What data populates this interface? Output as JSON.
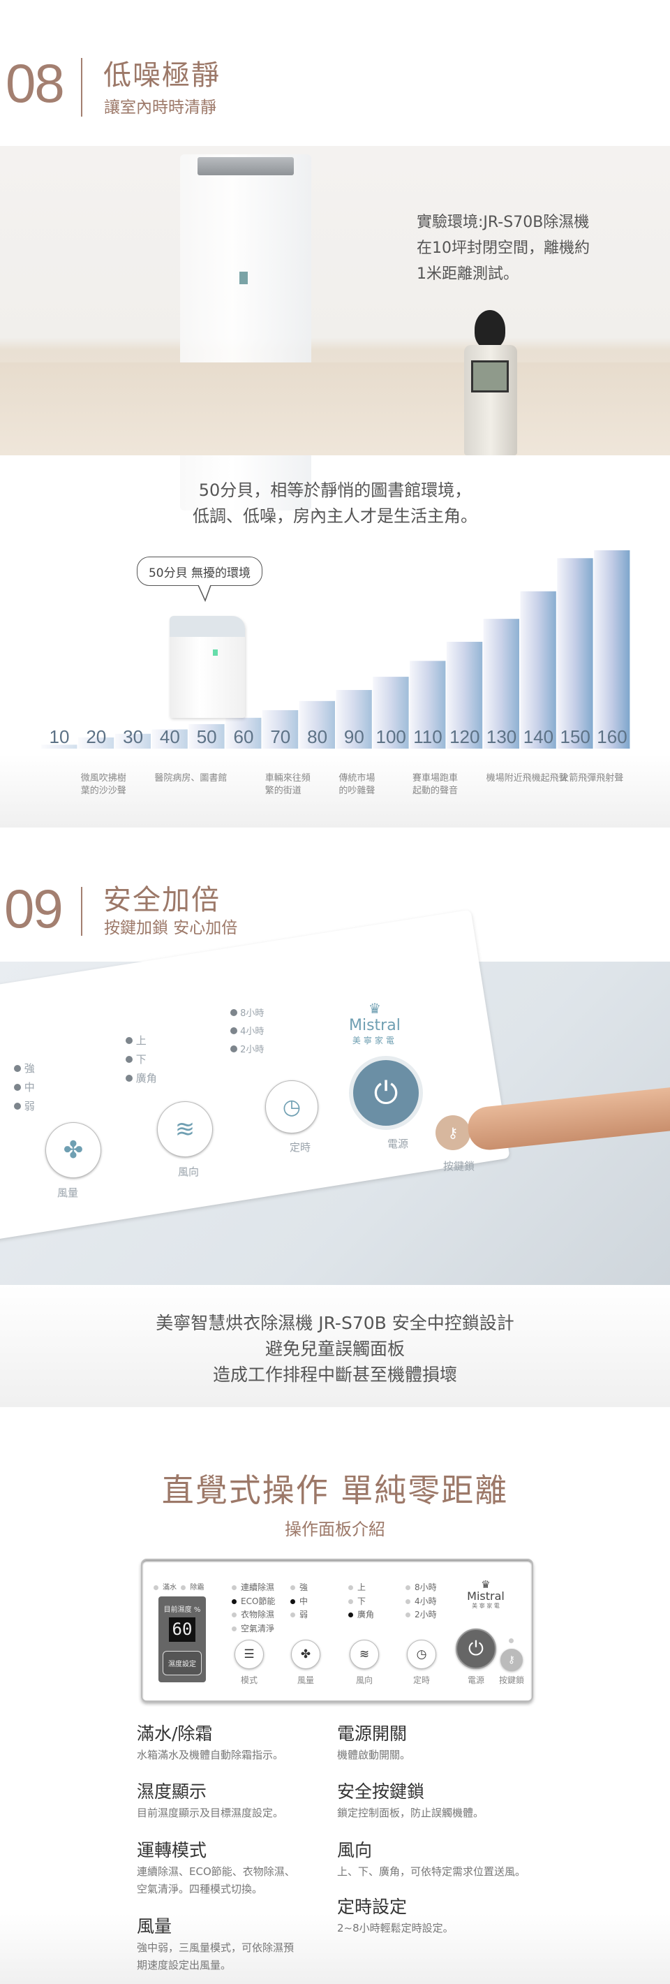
{
  "colors": {
    "accent": "#9c7868",
    "chart_blue": "#7ea6cc",
    "text": "#555555"
  },
  "section08": {
    "number": "08",
    "title": "低噪極靜",
    "subtitle": "讓室內時時清靜",
    "photo_text": [
      "實驗環境:JR-S70B除濕機",
      "在10坪封閉空間，離機約",
      "1米距離測試。"
    ],
    "lead": [
      "50分貝，相等於靜悄的圖書館環境，",
      "低調、低噪，房內主人才是生活主角。"
    ],
    "bubble": "50分貝 無擾的環境"
  },
  "chart_data": {
    "type": "area",
    "categories": [
      "10",
      "20",
      "30",
      "40",
      "50",
      "60",
      "70",
      "80",
      "90",
      "100",
      "110",
      "120",
      "130",
      "140",
      "150",
      "160"
    ],
    "values": [
      10,
      20,
      30,
      40,
      50,
      60,
      70,
      80,
      90,
      100,
      110,
      120,
      130,
      140,
      150,
      160
    ],
    "annotations": [
      {
        "at": "20",
        "text": [
          "微風吹拂樹",
          "葉的沙沙聲"
        ]
      },
      {
        "at": "40",
        "text": [
          "醫院病房、圖書館"
        ]
      },
      {
        "at": "70",
        "text": [
          "車輛來往頻",
          "繁的街道"
        ]
      },
      {
        "at": "90",
        "text": [
          "傳統市場",
          "的吵雜聲"
        ]
      },
      {
        "at": "110",
        "text": [
          "賽車場跑車",
          "起動的聲音"
        ]
      },
      {
        "at": "130",
        "text": [
          "機場附近飛機起飛聲"
        ]
      },
      {
        "at": "150",
        "text": [
          "火箭飛彈飛射聲"
        ]
      }
    ],
    "highlight": "50",
    "grid": false
  },
  "section09": {
    "number": "09",
    "title": "安全加倍",
    "subtitle": "按鍵加鎖 安心加倍",
    "photo_labels": {
      "fan": [
        "強",
        "中",
        "弱"
      ],
      "dir": [
        "上",
        "下",
        "廣角"
      ],
      "timer": [
        "8小時",
        "4小時",
        "2小時"
      ],
      "buttons": [
        "風量",
        "風向",
        "定時",
        "電源",
        "按鍵鎖"
      ],
      "brand": "Mistral",
      "brand_cn": "美寧家電"
    },
    "caption": [
      "美寧智慧烘衣除濕機 JR-S70B 安全中控鎖設計",
      "避免兒童誤觸面板",
      "造成工作排程中斷甚至機體損壞"
    ]
  },
  "panel_section": {
    "title": "直覺式操作 單純零距離",
    "subtitle": "操作面板介紹",
    "panel": {
      "indicators": [
        "滿水",
        "除霜"
      ],
      "humidity_label": "目前濕度 %",
      "humidity_value": "60",
      "humidity_button": "濕度設定",
      "modes": [
        {
          "label": "連續除濕",
          "on": false
        },
        {
          "label": "ECO節能",
          "on": true
        },
        {
          "label": "衣物除濕",
          "on": false
        },
        {
          "label": "空氣清淨",
          "on": false
        }
      ],
      "fan": [
        {
          "label": "強",
          "on": false
        },
        {
          "label": "中",
          "on": true
        },
        {
          "label": "弱",
          "on": false
        }
      ],
      "dir": [
        {
          "label": "上",
          "on": false
        },
        {
          "label": "下",
          "on": false
        },
        {
          "label": "廣角",
          "on": true
        }
      ],
      "timer": [
        {
          "label": "8小時",
          "on": false
        },
        {
          "label": "4小時",
          "on": false
        },
        {
          "label": "2小時",
          "on": false
        }
      ],
      "brand": "Mistral",
      "brand_cn": "美 寧 家 電",
      "buttons": [
        {
          "label": "模式",
          "icon": "list-icon"
        },
        {
          "label": "風量",
          "icon": "fan-icon"
        },
        {
          "label": "風向",
          "icon": "wave-icon"
        },
        {
          "label": "定時",
          "icon": "clock-icon"
        },
        {
          "label": "電源",
          "icon": "power-icon"
        },
        {
          "label": "按鍵鎖",
          "icon": "key-icon"
        }
      ]
    },
    "features_left": [
      {
        "title": "滿水/除霜",
        "desc": [
          "水箱滿水及機體自動除霜指示。"
        ]
      },
      {
        "title": "濕度顯示",
        "desc": [
          "目前濕度顯示及目標濕度設定。"
        ]
      },
      {
        "title": "運轉模式",
        "desc": [
          "連續除濕、ECO節能、衣物除濕、",
          "空氣清淨。四種模式切換。"
        ]
      },
      {
        "title": "風量",
        "desc": [
          "強中弱，三風量模式，可依除濕預",
          "期速度設定出風量。"
        ]
      }
    ],
    "features_right": [
      {
        "title": "電源開關",
        "desc": [
          "機體啟動開關。"
        ]
      },
      {
        "title": "安全按鍵鎖",
        "desc": [
          "鎖定控制面板，防止誤觸機體。"
        ]
      },
      {
        "title": "風向",
        "desc": [
          "上、下、廣角，可依特定需求位置送風。"
        ]
      },
      {
        "title": "定時設定",
        "desc": [
          "2~8小時輕鬆定時設定。"
        ]
      }
    ]
  }
}
